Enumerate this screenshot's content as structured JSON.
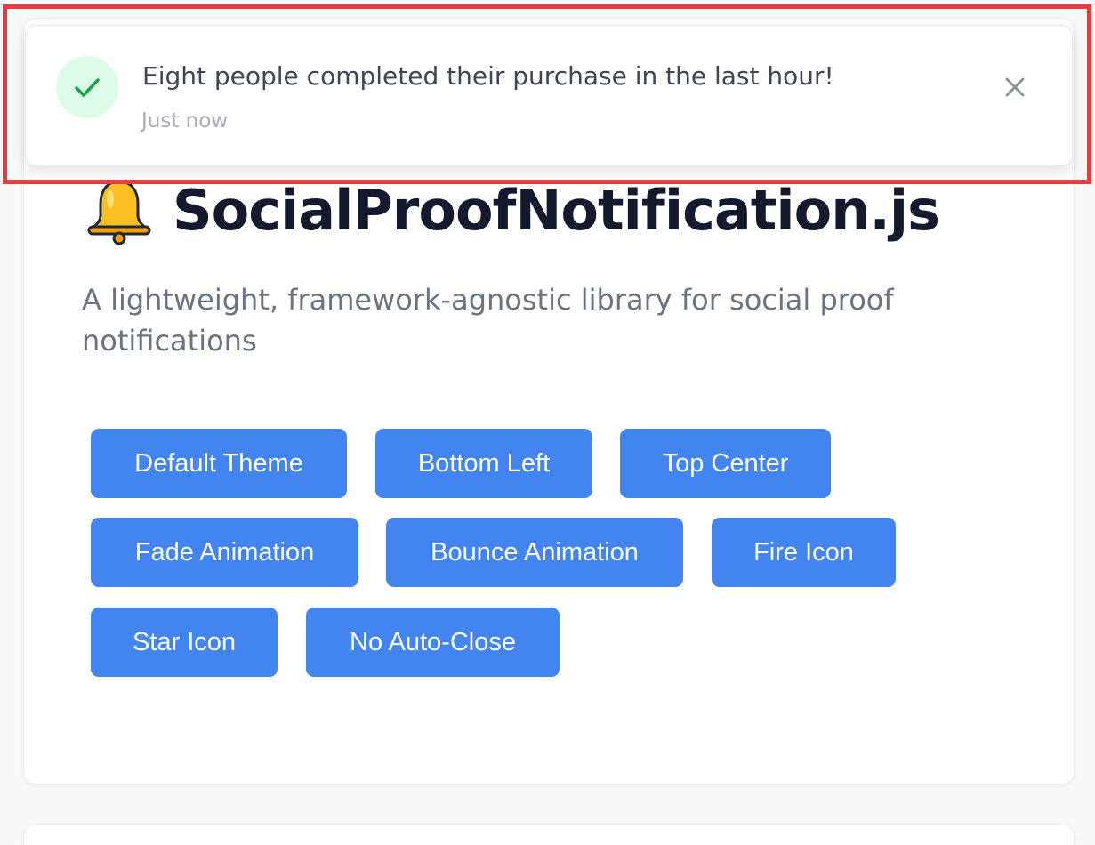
{
  "header": {
    "title": "SocialProofNotification.js",
    "subtitle": "A lightweight, framework-agnostic library for social proof notifications",
    "emoji_icon": "bell-icon"
  },
  "demo_buttons": [
    {
      "label": "Default Theme"
    },
    {
      "label": "Bottom Left"
    },
    {
      "label": "Top Center"
    },
    {
      "label": "Fade Animation"
    },
    {
      "label": "Bounce Animation"
    },
    {
      "label": "Fire Icon"
    },
    {
      "label": "Star Icon"
    },
    {
      "label": "No Auto-Close"
    }
  ],
  "notification": {
    "message": "Eight people completed their purchase in the last hour!",
    "time": "Just now",
    "icon": "check-icon",
    "close_icon": "close-icon"
  },
  "colors": {
    "primary": "#4285f0",
    "title": "#141a2e",
    "subtitle": "#6b7280",
    "success_bg": "#dcfce7",
    "success_check": "#16a34a",
    "highlight": "#e53e3e"
  }
}
